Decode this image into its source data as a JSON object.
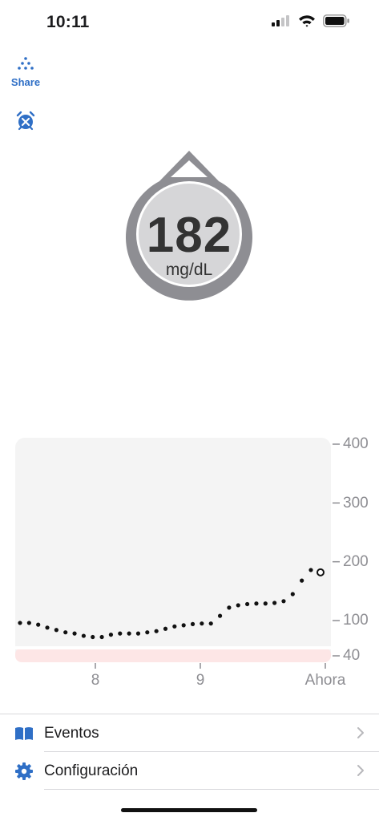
{
  "status_bar": {
    "time": "10:11",
    "icons": [
      "cellular-signal-icon",
      "wifi-icon",
      "battery-icon"
    ]
  },
  "toolbar": {
    "share_label": "Share",
    "share_icon": "share-dots-icon",
    "alarm_icon": "alarm-muted-icon",
    "accent_color": "#2f6fc6"
  },
  "reading": {
    "value": "182",
    "unit": "mg/dL",
    "trend": "flat",
    "badge_color": "#8e8e93"
  },
  "chart_data": {
    "type": "scatter",
    "x_ticks": [
      "8",
      "9",
      "Ahora"
    ],
    "y_ticks": [
      "400",
      "300",
      "200",
      "100",
      "40"
    ],
    "ylim": [
      40,
      400
    ],
    "low_band_color": "#fde6e6",
    "grid": false,
    "series": [
      {
        "values": [
          96,
          96,
          93,
          88,
          84,
          80,
          78,
          74,
          72,
          72,
          76,
          78,
          78,
          78,
          80,
          82,
          86,
          90,
          92,
          94,
          95,
          95,
          108,
          122,
          126,
          128,
          129,
          129,
          130,
          133,
          145,
          168,
          186
        ]
      }
    ],
    "current_point": 182
  },
  "menu": {
    "items": [
      {
        "label": "Eventos",
        "icon": "book-icon"
      },
      {
        "label": "Configuración",
        "icon": "gear-icon"
      }
    ]
  }
}
